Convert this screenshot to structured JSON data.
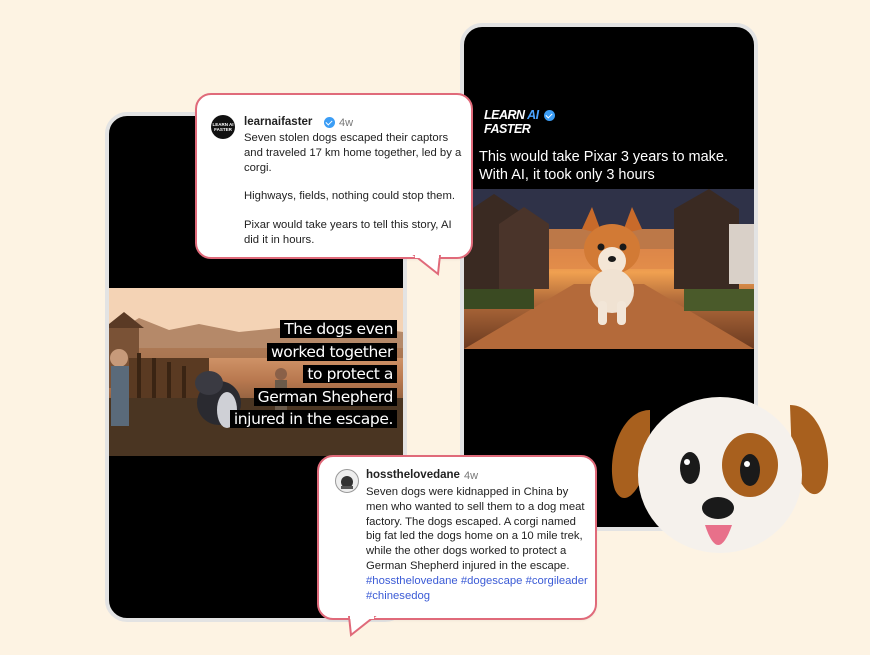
{
  "left_post": {
    "caption_lines": [
      "The dogs even",
      "worked together",
      "to protect a",
      "German Shepherd",
      "injured in the escape."
    ]
  },
  "right_post": {
    "logo_line1": "LEARN",
    "logo_ai": "AI",
    "logo_line2": "FASTER",
    "headline": "This would take Pixar 3 years to make. With AI, it took only 3 hours"
  },
  "comment_top": {
    "avatar_text": "LEARN AI FASTER",
    "username": "learnaifaster",
    "verified": true,
    "time": "4w",
    "paragraphs": [
      "Seven stolen dogs escaped their captors and traveled 17 km home together, led by a corgi.",
      "Highways, fields, nothing could stop them.",
      "Pixar would take years to tell this story, AI did it in hours."
    ]
  },
  "comment_bottom": {
    "username": "hossthelovedane",
    "time": "4w",
    "text": "Seven dogs were kidnapped in China by men who wanted to sell them to a dog meat factory.  The dogs escaped. A corgi named big fat led the dogs home on a 10 mile trek, while the other dogs worked to protect a German Shepherd injured in the escape.",
    "hashtags": [
      "#hossthelovedane",
      "#dogescape",
      "#corgileader",
      "#chinesedog"
    ]
  },
  "colors": {
    "background": "#fdf3e3",
    "bubble_border": "#e06a7a",
    "hashtag": "#3b5bd6",
    "verified": "#3b9df5"
  },
  "icons": [
    "verified-badge-icon",
    "dog-emoji-icon"
  ]
}
